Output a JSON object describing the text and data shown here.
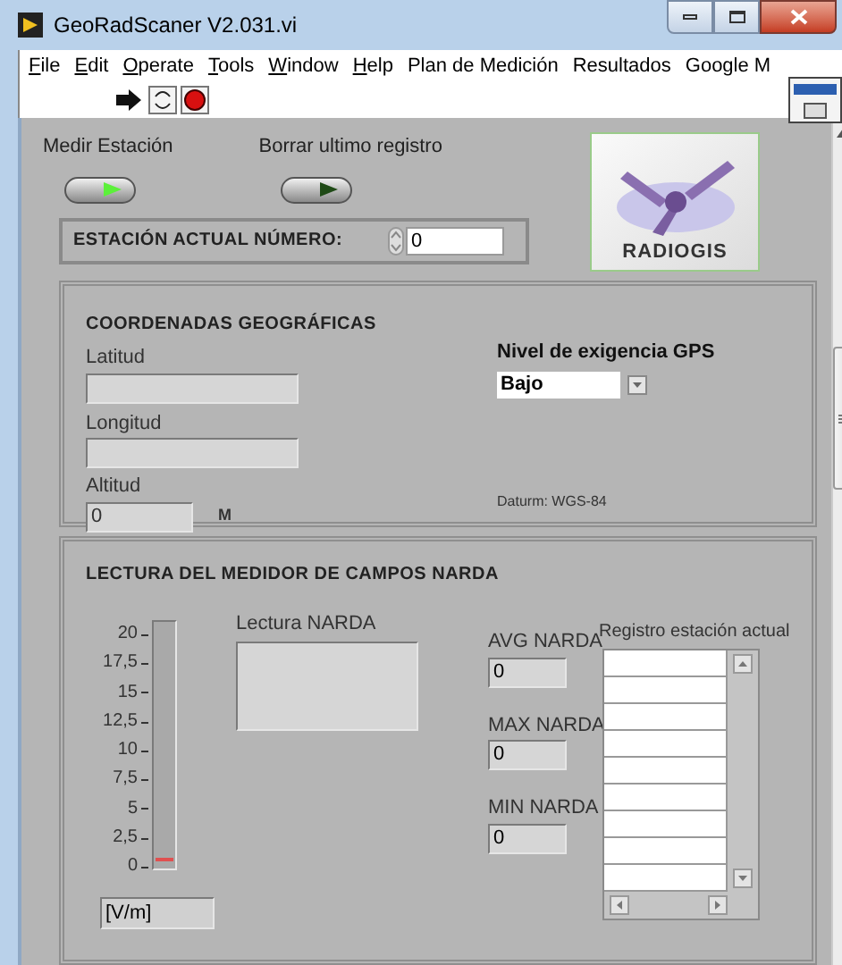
{
  "window": {
    "title": "GeoRadScaner V2.031.vi"
  },
  "menu": [
    {
      "label": "File",
      "mnemonic": true
    },
    {
      "label": "Edit",
      "mnemonic": true
    },
    {
      "label": "Operate",
      "mnemonic": true
    },
    {
      "label": "Tools",
      "mnemonic": true
    },
    {
      "label": "Window",
      "mnemonic": true
    },
    {
      "label": "Help",
      "mnemonic": true
    },
    {
      "label": "Plan de Medición",
      "mnemonic": false
    },
    {
      "label": "Resultados",
      "mnemonic": false
    },
    {
      "label": "Google M",
      "mnemonic": false
    }
  ],
  "buttons": [
    {
      "label": "Medir Estación",
      "on": true
    },
    {
      "label": "Borrar ultimo registro",
      "on": false
    }
  ],
  "station": {
    "label": "ESTACIÓN ACTUAL NÚMERO:",
    "value": "0"
  },
  "logo": {
    "text": "RADIOGIS"
  },
  "coordinates": {
    "title": "COORDENADAS GEOGRÁFICAS",
    "latitude": {
      "label": "Latitud"
    },
    "longitude": {
      "label": "Longitud"
    },
    "altitude": {
      "label": "Altitud",
      "value": "0",
      "unit": "M"
    },
    "gps": {
      "label": "Nivel de exigencia GPS",
      "value": "Bajo"
    },
    "datum": "Daturm: WGS-84"
  },
  "reading": {
    "title": "LECTURA DEL MEDIDOR DE CAMPOS NARDA",
    "meter": {
      "ticks": [
        "20",
        "17,5",
        "15",
        "12,5",
        "10",
        "7,5",
        "5",
        "2,5",
        "0"
      ],
      "level": 0,
      "unit": "[V/m]"
    },
    "lectura": {
      "label": "Lectura NARDA"
    },
    "stats": [
      {
        "label": "AVG NARDA",
        "value": "0"
      },
      {
        "label": "MAX NARDA",
        "value": "0"
      },
      {
        "label": "MIN NARDA",
        "value": "0"
      }
    ],
    "log": {
      "label": "Registro estación actual"
    }
  }
}
